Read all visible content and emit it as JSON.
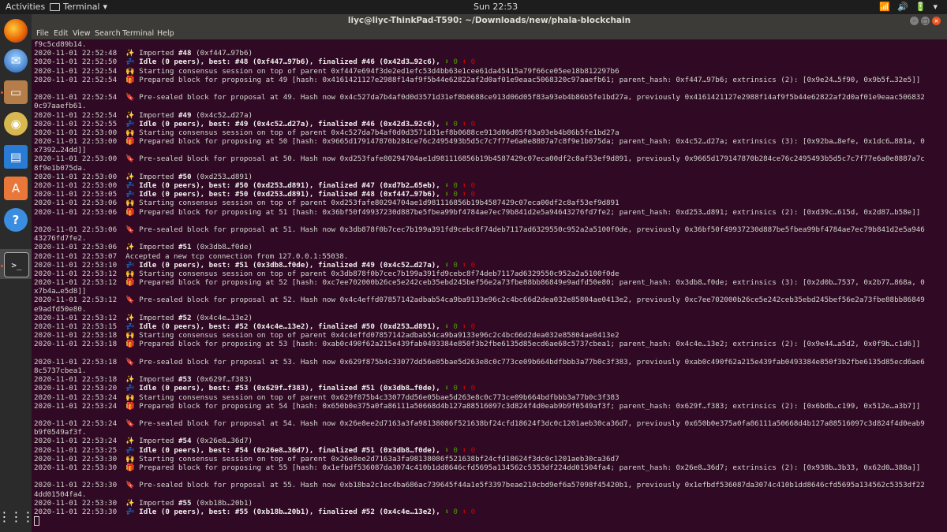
{
  "topbar": {
    "activities": "Activities",
    "app": "Terminal",
    "clock": "Sun 22:53",
    "tray": [
      "📶",
      "🔊",
      "🔋",
      "▾"
    ]
  },
  "window": {
    "title": "liyc@liyc-ThinkPad-T590: ~/Downloads/new/phala-blockchain"
  },
  "menu": [
    "File",
    "Edit",
    "View",
    "Search",
    "Terminal",
    "Help"
  ],
  "dock": [
    "Firefox",
    "Thunderbird",
    "Files",
    "Rhythmbox",
    "Writer",
    "Software",
    "Help",
    "Terminal",
    "Apps"
  ],
  "glyphs": {
    "imported": "✨",
    "idle": "💤",
    "starting": "🙌",
    "prepared": "🎁",
    "presealed": "🔖",
    "down": "⬇",
    "up": "⬆"
  },
  "lines": [
    {
      "k": "t",
      "text": "f9c5cd89b14."
    },
    {
      "k": "imp",
      "ts": "2020-11-01 22:52:48",
      "num": "#48",
      "hash": "(0xf447…97b6)"
    },
    {
      "k": "idle",
      "ts": "2020-11-01 22:52:50",
      "p1": "Idle (0 peers), best: #48 (0xf447…97b6), finalized #46 (0x42d3…92c6),",
      "a": "0",
      "b": "0"
    },
    {
      "k": "start",
      "ts": "2020-11-01 22:52:54",
      "text": "Starting consensus session on top of parent 0xf447e694f3de2ed1efc53d4bb63e1cee61da45415a79f66ce05ee18b812297b6"
    },
    {
      "k": "prep",
      "ts": "2020-11-01 22:52:54",
      "text": "Prepared block for proposing at 49 [hash: 0x4161421127e2988f14af9f5b44e62822af2d0af01e9eaac5068320c97aaefb61; parent_hash: 0xf447…97b6; extrinsics (2): [0x9e24…5f90, 0x9b5f…32e5]]"
    },
    {
      "k": "blank"
    },
    {
      "k": "seal",
      "ts": "2020-11-01 22:52:54",
      "text": "Pre-sealed block for proposal at 49. Hash now 0x4c527da7b4af0d0d3571d31ef8b0688ce913d06d05f83a93eb4b86b5fe1bd27a, previously 0x4161421127e2988f14af9f5b44e62822af2d0af01e9eaac506832"
    },
    {
      "k": "t",
      "text": "0c97aaefb61."
    },
    {
      "k": "imp",
      "ts": "2020-11-01 22:52:54",
      "num": "#49",
      "hash": "(0x4c52…d27a)"
    },
    {
      "k": "idle",
      "ts": "2020-11-01 22:52:55",
      "p1": "Idle (0 peers), best: #49 (0x4c52…d27a), finalized #46 (0x42d3…92c6),",
      "a": "0",
      "b": "0"
    },
    {
      "k": "start",
      "ts": "2020-11-01 22:53:00",
      "text": "Starting consensus session on top of parent 0x4c527da7b4af0d0d3571d31ef8b0688ce913d06d05f83a93eb4b86b5fe1bd27a"
    },
    {
      "k": "prep",
      "ts": "2020-11-01 22:53:00",
      "text": "Prepared block for proposing at 50 [hash: 0x9665d179147870b284ce76c2495493b5d5c7c7f77e6a0e8887a7c8f9e1b075da; parent_hash: 0x4c52…d27a; extrinsics (3): [0x92ba…8efe, 0x1dc6…881a, 0"
    },
    {
      "k": "t",
      "text": "x7392…24dd]]"
    },
    {
      "k": "seal",
      "ts": "2020-11-01 22:53:00",
      "text": "Pre-sealed block for proposal at 50. Hash now 0xd253fafe80294704ae1d981116856b19b4587429c07eca00df2c8af53ef9d891, previously 0x9665d179147870b284ce76c2495493b5d5c7c7f77e6a0e8887a7c"
    },
    {
      "k": "t",
      "text": "8f9e1b075da."
    },
    {
      "k": "imp",
      "ts": "2020-11-01 22:53:00",
      "num": "#50",
      "hash": "(0xd253…d891)"
    },
    {
      "k": "idle",
      "ts": "2020-11-01 22:53:00",
      "p1": "Idle (0 peers), best: #50 (0xd253…d891), finalized #47 (0xd7b2…65eb),",
      "a": "0",
      "b": "0"
    },
    {
      "k": "idle",
      "ts": "2020-11-01 22:53:05",
      "p1": "Idle (0 peers), best: #50 (0xd253…d891), finalized #48 (0xf447…97b6),",
      "a": "0",
      "b": "0"
    },
    {
      "k": "start",
      "ts": "2020-11-01 22:53:06",
      "text": "Starting consensus session on top of parent 0xd253fafe80294704ae1d981116856b19b4587429c07eca00df2c8af53ef9d891"
    },
    {
      "k": "prep",
      "ts": "2020-11-01 22:53:06",
      "text": "Prepared block for proposing at 51 [hash: 0x36bf50f49937230d887be5fbea99bf4784ae7ec79b841d2e5a94643276fd7fe2; parent_hash: 0xd253…d891; extrinsics (2): [0xd39c…615d, 0x2d87…b58e]]"
    },
    {
      "k": "blank"
    },
    {
      "k": "seal",
      "ts": "2020-11-01 22:53:06",
      "text": "Pre-sealed block for proposal at 51. Hash now 0x3db878f0b7cec7b199a391fd9cebc8f74deb7117ad6329550c952a2a5100f0de, previously 0x36bf50f49937230d887be5fbea99bf4784ae7ec79b841d2e5a946"
    },
    {
      "k": "t",
      "text": "43276fd7fe2."
    },
    {
      "k": "imp",
      "ts": "2020-11-01 22:53:06",
      "num": "#51",
      "hash": "(0x3db8…f0de)"
    },
    {
      "k": "plain",
      "ts": "2020-11-01 22:53:07",
      "text": "Accepted a new tcp connection from 127.0.0.1:55038."
    },
    {
      "k": "idle",
      "ts": "2020-11-01 22:53:10",
      "p1": "Idle (0 peers), best: #51 (0x3db8…f0de), finalized #49 (0x4c52…d27a),",
      "a": "0",
      "b": "0"
    },
    {
      "k": "start",
      "ts": "2020-11-01 22:53:12",
      "text": "Starting consensus session on top of parent 0x3db878f0b7cec7b199a391fd9cebc8f74deb7117ad6329550c952a2a5100f0de"
    },
    {
      "k": "prep",
      "ts": "2020-11-01 22:53:12",
      "text": "Prepared block for proposing at 52 [hash: 0xc7ee702000b26ce5e242ceb35ebd245bef56e2a73fbe88bb86849e9adfd50e80; parent_hash: 0x3db8…f0de; extrinsics (3): [0x2d0b…7537, 0x2b77…868a, 0"
    },
    {
      "k": "t",
      "text": "x7b4a…e5d8]]"
    },
    {
      "k": "seal",
      "ts": "2020-11-01 22:53:12",
      "text": "Pre-sealed block for proposal at 52. Hash now 0x4c4effd07857142adbab54ca9ba9133e96c2c4bc66d2dea032e85804ae0413e2, previously 0xc7ee702000b26ce5e242ceb35ebd245bef56e2a73fbe88bb86849"
    },
    {
      "k": "t",
      "text": "e9adfd50e80."
    },
    {
      "k": "imp",
      "ts": "2020-11-01 22:53:12",
      "num": "#52",
      "hash": "(0x4c4e…13e2)"
    },
    {
      "k": "idle",
      "ts": "2020-11-01 22:53:15",
      "p1": "Idle (0 peers), best: #52 (0x4c4e…13e2), finalized #50 (0xd253…d891),",
      "a": "0",
      "b": "0"
    },
    {
      "k": "start",
      "ts": "2020-11-01 22:53:18",
      "text": "Starting consensus session on top of parent 0x4c4effd07857142adbab54ca9ba9133e96c2c4bc66d2dea032e85804ae0413e2"
    },
    {
      "k": "prep",
      "ts": "2020-11-01 22:53:18",
      "text": "Prepared block for proposing at 53 [hash: 0xab0c490f62a215e439fab0493384e850f3b2fbe6135d85ecd6ae68c5737cbea1; parent_hash: 0x4c4e…13e2; extrinsics (2): [0x9e44…a5d2, 0x0f9b…c1d6]]"
    },
    {
      "k": "blank"
    },
    {
      "k": "seal",
      "ts": "2020-11-01 22:53:18",
      "text": "Pre-sealed block for proposal at 53. Hash now 0x629f875b4c33077dd56e05bae5d263e8c0c773ce09b664bdfbbb3a77b0c3f383, previously 0xab0c490f62a215e439fab0493384e850f3b2fbe6135d85ecd6ae6"
    },
    {
      "k": "t",
      "text": "8c5737cbea1."
    },
    {
      "k": "imp",
      "ts": "2020-11-01 22:53:18",
      "num": "#53",
      "hash": "(0x629f…f383)"
    },
    {
      "k": "idle",
      "ts": "2020-11-01 22:53:20",
      "p1": "Idle (0 peers), best: #53 (0x629f…f383), finalized #51 (0x3db8…f0de),",
      "a": "0",
      "b": "0"
    },
    {
      "k": "start",
      "ts": "2020-11-01 22:53:24",
      "text": "Starting consensus session on top of parent 0x629f875b4c33077dd56e05bae5d263e8c0c773ce09b664bdfbbb3a77b0c3f383"
    },
    {
      "k": "prep",
      "ts": "2020-11-01 22:53:24",
      "text": "Prepared block for proposing at 54 [hash: 0x650b0e375a0fa86111a50668d4b127a88516097c3d824f4d0eab9b9f0549af3f; parent_hash: 0x629f…f383; extrinsics (2): [0x6bdb…c199, 0x512e…a3b7]]"
    },
    {
      "k": "blank"
    },
    {
      "k": "seal",
      "ts": "2020-11-01 22:53:24",
      "text": "Pre-sealed block for proposal at 54. Hash now 0x26e8ee2d7163a3fa98138086f521638bf24cfd18624f3dc0c1201aeb30ca36d7, previously 0x650b0e375a0fa86111a50668d4b127a88516097c3d824f4d0eab9"
    },
    {
      "k": "t",
      "text": "b9f0549af3f."
    },
    {
      "k": "imp",
      "ts": "2020-11-01 22:53:24",
      "num": "#54",
      "hash": "(0x26e8…36d7)"
    },
    {
      "k": "idle",
      "ts": "2020-11-01 22:53:25",
      "p1": "Idle (0 peers), best: #54 (0x26e8…36d7), finalized #51 (0x3db8…f0de),",
      "a": "0",
      "b": "0"
    },
    {
      "k": "start",
      "ts": "2020-11-01 22:53:30",
      "text": "Starting consensus session on top of parent 0x26e8ee2d7163a3fa98138086f521638bf24cfd18624f3dc0c1201aeb30ca36d7"
    },
    {
      "k": "prep",
      "ts": "2020-11-01 22:53:30",
      "text": "Prepared block for proposing at 55 [hash: 0x1efbdf536087da3074c410b1dd8646cfd5695a134562c5353df224dd01504fa4; parent_hash: 0x26e8…36d7; extrinsics (2): [0x938b…3b33, 0x62d0…388a]]"
    },
    {
      "k": "blank"
    },
    {
      "k": "seal",
      "ts": "2020-11-01 22:53:30",
      "text": "Pre-sealed block for proposal at 55. Hash now 0xb18ba2c1ec4ba686ac739645f44a1e5f3397beae210cbd9ef6a57098f45420b1, previously 0x1efbdf536087da3074c410b1dd8646cfd5695a134562c5353df22"
    },
    {
      "k": "t",
      "text": "4dd01504fa4."
    },
    {
      "k": "imp",
      "ts": "2020-11-01 22:53:30",
      "num": "#55",
      "hash": "(0xb18b…20b1)"
    },
    {
      "k": "idle",
      "ts": "2020-11-01 22:53:30",
      "p1": "Idle (0 peers), best: #55 (0xb18b…20b1), finalized #52 (0x4c4e…13e2),",
      "a": "0",
      "b": "0"
    }
  ]
}
